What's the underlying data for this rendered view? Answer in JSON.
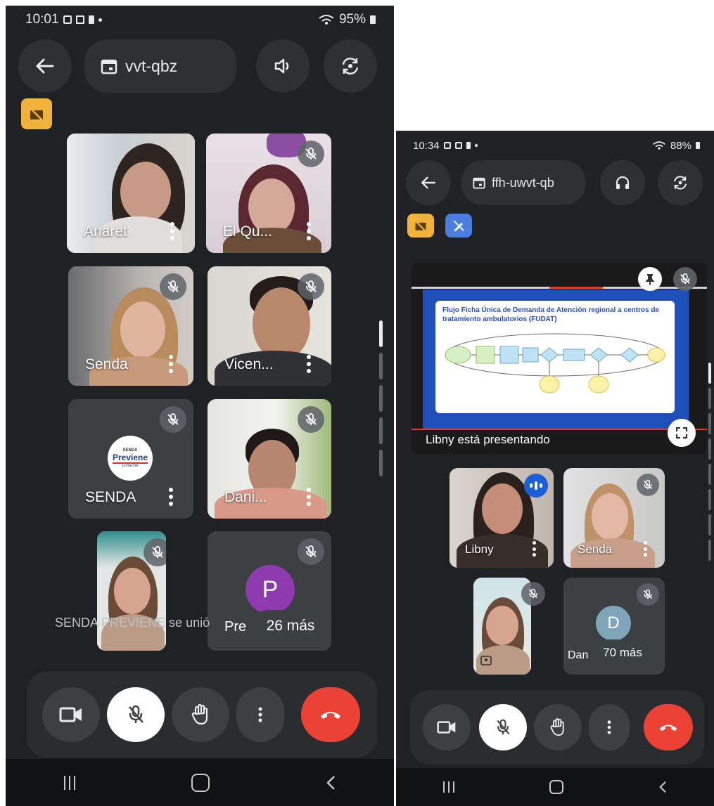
{
  "left": {
    "status": {
      "time": "10:01",
      "battery": "95%"
    },
    "meeting_code": "vvt-qbz",
    "participants": [
      {
        "name": "Anaret"
      },
      {
        "name": "El Qu..."
      },
      {
        "name": "Senda"
      },
      {
        "name": "Vicen..."
      },
      {
        "name": "SENDA"
      },
      {
        "name": "Dani..."
      }
    ],
    "senda_logo": {
      "top": "SENDA",
      "word": "Previene",
      "sub": "Limache"
    },
    "avatar_letter": "P",
    "presenter_partial_name": "Pre",
    "toast_text": "SENDA PREVIENE se unió",
    "more_label": "26 más"
  },
  "right": {
    "status": {
      "time": "10:34",
      "battery": "88%"
    },
    "meeting_code": "ffh-uwvt-qb",
    "slide_title": "Flujo Ficha Única de Demanda de Atención regional a centros de tratamiento ambulatorios (FUDAT)",
    "presenting_label": "Libny está presentando",
    "participants": [
      {
        "name": "Libny"
      },
      {
        "name": "Senda"
      }
    ],
    "avatar_letter": "D",
    "partial_name": "Dan",
    "more_label": "70 más"
  },
  "colors": {
    "bg": "#202124",
    "accent_blue": "#4b7fd6",
    "hangup_red": "#ea4335",
    "chip_yellow": "#f2b33d",
    "chip_blue": "#4a7fe0",
    "avatar_purple": "#8e3bb0",
    "avatar_teal": "#7fa6b8"
  }
}
